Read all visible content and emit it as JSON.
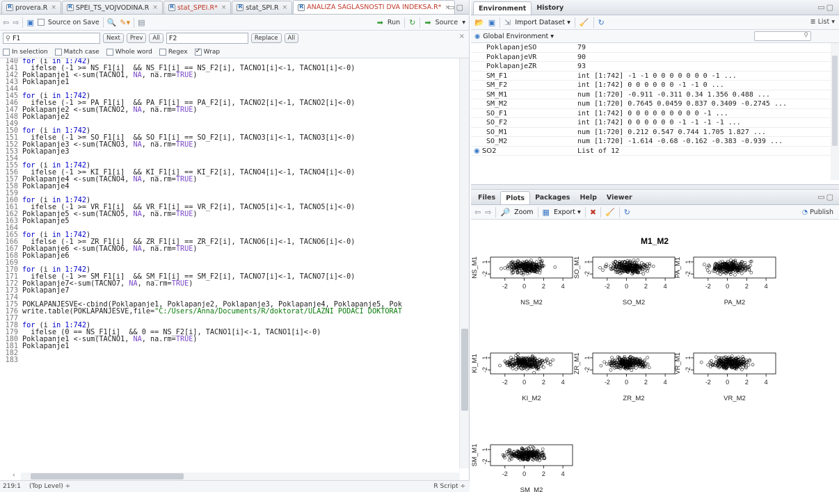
{
  "source_tabs": [
    {
      "label": "provera.R",
      "modified": false
    },
    {
      "label": "SPEI_TS_VOJVODINA.R",
      "modified": false
    },
    {
      "label": "stat_SPEI.R*",
      "modified": true
    },
    {
      "label": "stat_SPI.R",
      "modified": false
    },
    {
      "label": "ANALIZA SAGLASNOSTI DVA INDEKSA.R*",
      "modified": true,
      "active": true
    }
  ],
  "toolbar": {
    "source_on_save": "Source on Save",
    "run": "Run",
    "source": "Source"
  },
  "find": {
    "query": "F1",
    "next": "Next",
    "prev": "Prev",
    "all": "All",
    "replace_value": "F2",
    "replace": "Replace",
    "replace_all": "All",
    "in_selection": "In selection",
    "match_case": "Match case",
    "whole_word": "Whole word",
    "regex": "Regex",
    "wrap": "Wrap"
  },
  "code": [
    {
      "n": "140",
      "t": "for (i in 1:742)"
    },
    {
      "n": "141",
      "t": "  ifelse (-1 >= NS_F1[i]  && NS_F1[i] == NS_F2[i], TACNO1[i]<-1, TACNO1[i]<-0)"
    },
    {
      "n": "142",
      "t": "Poklapanje1 <-sum(TACNO1, NA, na.rm=TRUE)"
    },
    {
      "n": "143",
      "t": "Poklapanje1"
    },
    {
      "n": "144",
      "t": ""
    },
    {
      "n": "145",
      "t": "for (i in 1:742)"
    },
    {
      "n": "146",
      "t": "  ifelse (-1 >= PA_F1[i]  && PA_F1[i] == PA_F2[i], TACNO2[i]<-1, TACNO2[i]<-0)"
    },
    {
      "n": "147",
      "t": "Poklapanje2 <-sum(TACNO2, NA, na.rm=TRUE)"
    },
    {
      "n": "148",
      "t": "Poklapanje2"
    },
    {
      "n": "149",
      "t": ""
    },
    {
      "n": "150",
      "t": "for (i in 1:742)"
    },
    {
      "n": "151",
      "t": "  ifelse (-1 >= SO_F1[i]  && SO_F1[i] == SO_F2[i], TACNO3[i]<-1, TACNO3[i]<-0)"
    },
    {
      "n": "152",
      "t": "Poklapanje3 <-sum(TACNO3, NA, na.rm=TRUE)"
    },
    {
      "n": "153",
      "t": "Poklapanje3"
    },
    {
      "n": "154",
      "t": ""
    },
    {
      "n": "155",
      "t": "for (i in 1:742)"
    },
    {
      "n": "156",
      "t": "  ifelse (-1 >= KI_F1[i]  && KI_F1[i] == KI_F2[i], TACNO4[i]<-1, TACNO4[i]<-0)"
    },
    {
      "n": "157",
      "t": "Poklapanje4 <-sum(TACNO4, NA, na.rm=TRUE)"
    },
    {
      "n": "158",
      "t": "Poklapanje4"
    },
    {
      "n": "159",
      "t": ""
    },
    {
      "n": "160",
      "t": "for (i in 1:742)"
    },
    {
      "n": "161",
      "t": "  ifelse (-1 >= VR_F1[i]  && VR_F1[i] == VR_F2[i], TACNO5[i]<-1, TACNO5[i]<-0)"
    },
    {
      "n": "162",
      "t": "Poklapanje5 <-sum(TACNO5, NA, na.rm=TRUE)"
    },
    {
      "n": "163",
      "t": "Poklapanje5"
    },
    {
      "n": "164",
      "t": ""
    },
    {
      "n": "165",
      "t": "for (i in 1:742)"
    },
    {
      "n": "166",
      "t": "  ifelse (-1 >= ZR_F1[i]  && ZR_F1[i] == ZR_F2[i], TACNO6[i]<-1, TACNO6[i]<-0)"
    },
    {
      "n": "167",
      "t": "Poklapanje6 <-sum(TACNO6, NA, na.rm=TRUE)"
    },
    {
      "n": "168",
      "t": "Poklapanje6"
    },
    {
      "n": "169",
      "t": ""
    },
    {
      "n": "170",
      "t": "for (i in 1:742)"
    },
    {
      "n": "171",
      "t": "  ifelse (-1 >= SM_F1[i]  && SM_F1[i] == SM_F2[i], TACNO7[i]<-1, TACNO7[i]<-0)"
    },
    {
      "n": "172",
      "t": "Poklapanje7<-sum(TACNO7, NA, na.rm=TRUE)"
    },
    {
      "n": "173",
      "t": "Poklapanje7"
    },
    {
      "n": "174",
      "t": ""
    },
    {
      "n": "175",
      "t": "POKLAPANJESVE<-cbind(Poklapanje1, Poklapanje2, Poklapanje3, Poklapanje4, Poklapanje5, Pok"
    },
    {
      "n": "176",
      "t": "write.table(POKLAPANJESVE,file=\"C:/Users/Anna/Documents/R/doktorat/ULAZNI PODACI DOKTORAT"
    },
    {
      "n": "177",
      "t": ""
    },
    {
      "n": "178",
      "t": "for (i in 1:742)"
    },
    {
      "n": "179",
      "t": "  ifelse (0 == NS_F1[i]  && 0 == NS_F2[i], TACNO1[i]<-1, TACNO1[i]<-0)"
    },
    {
      "n": "180",
      "t": "Poklapanje1 <-sum(TACNO1, NA, na.rm=TRUE)"
    },
    {
      "n": "181",
      "t": "Poklapanje1"
    },
    {
      "n": "182",
      "t": ""
    },
    {
      "n": "183",
      "t": ""
    }
  ],
  "status": {
    "position": "219:1",
    "scope": "(Top Level) ÷",
    "filetype": "R Script ÷"
  },
  "env": {
    "tabs": [
      "Environment",
      "History"
    ],
    "import_dataset": "Import Dataset ▾",
    "view": "≣ List ▾",
    "scope": "Global Environment ▾",
    "rows": [
      {
        "name": "PoklapanjeSO",
        "value": "79"
      },
      {
        "name": "PoklapanjeVR",
        "value": "90"
      },
      {
        "name": "PoklapanjeZR",
        "value": "93"
      },
      {
        "name": "SM_F1",
        "value": "int [1:742] -1 -1 0 0 0 0 0 0 0 -1 ..."
      },
      {
        "name": "SM_F2",
        "value": "int [1:742] 0 0 0 0 0 0 -1 -1 0 ..."
      },
      {
        "name": "SM_M1",
        "value": "num [1:720] -0.911 -0.311 0.34 1.356 0.488 ..."
      },
      {
        "name": "SM_M2",
        "value": "num [1:720] 0.7645 0.0459 0.837 0.3409 -0.2745 ..."
      },
      {
        "name": "SO_F1",
        "value": "int [1:742] 0 0 0 0 0 0 0 0 0 -1 ..."
      },
      {
        "name": "SO_F2",
        "value": "int [1:742] 0 0 0 0 0 0 -1 -1 -1 -1 ..."
      },
      {
        "name": "SO_M1",
        "value": "num [1:720] 0.212 0.547 0.744 1.705 1.827 ..."
      },
      {
        "name": "SO_M2",
        "value": "num [1:720] -1.614 -0.68 -0.162 -0.383 -0.939 ..."
      }
    ],
    "list_row": {
      "name": "SO2",
      "value": "List of 12"
    }
  },
  "plots": {
    "tabs": [
      "Files",
      "Plots",
      "Packages",
      "Help",
      "Viewer"
    ],
    "zoom": "Zoom",
    "export": "Export ▾",
    "publish": "Publish"
  },
  "chart_data": {
    "type": "scatter",
    "title": "M1_M2",
    "panels": [
      {
        "xlabel": "NS_M2",
        "ylabel": "NS_M1",
        "xticks": [
          -2,
          0,
          2,
          4
        ],
        "yticks": [
          1,
          -2
        ]
      },
      {
        "xlabel": "SO_M2",
        "ylabel": "SO_M1",
        "xticks": [
          -2,
          0,
          2,
          4
        ],
        "yticks": [
          1,
          -2
        ]
      },
      {
        "xlabel": "PA_M2",
        "ylabel": "PA_M1",
        "xticks": [
          -2,
          0,
          2,
          4
        ],
        "yticks": [
          1,
          -2
        ]
      },
      {
        "xlabel": "KI_M2",
        "ylabel": "KI_M1",
        "xticks": [
          -2,
          0,
          2,
          4
        ],
        "yticks": [
          1,
          -2
        ]
      },
      {
        "xlabel": "ZR_M2",
        "ylabel": "ZR_M1",
        "xticks": [
          -2,
          0,
          2,
          4
        ],
        "yticks": [
          1,
          -2
        ]
      },
      {
        "xlabel": "VR_M2",
        "ylabel": "VR_M1",
        "xticks": [
          -2,
          0,
          2,
          4
        ],
        "yticks": [
          1,
          -2
        ]
      },
      {
        "xlabel": "SM_M2",
        "ylabel": "SM_M1",
        "xticks": [
          -2,
          0,
          2,
          4
        ],
        "yticks": [
          1,
          -2
        ]
      }
    ]
  }
}
